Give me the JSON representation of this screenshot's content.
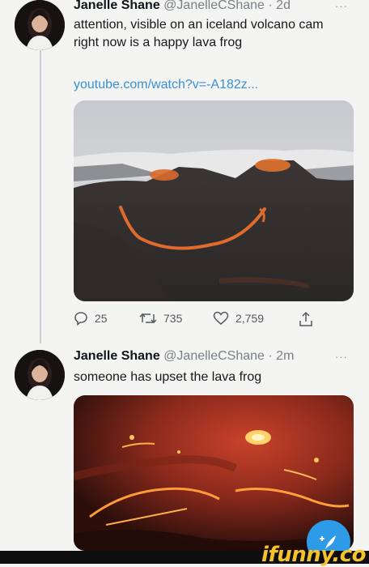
{
  "tweet1": {
    "author_name": "Janelle Shane",
    "handle": "@JanelleCShane",
    "separator": "·",
    "time": "2d",
    "more": "···",
    "text": "attention, visible on an iceland volcano cam right now is a happy lava frog",
    "link": "youtube.com/watch?v=-A182z...",
    "media_icon": "volcano-image",
    "actions": {
      "reply_count": "25",
      "retweet_count": "735",
      "like_count": "2,759"
    }
  },
  "tweet2": {
    "author_name": "Janelle Shane",
    "handle": "@JanelleCShane",
    "separator": "·",
    "time": "2m",
    "more": "···",
    "text": "someone has upset the lava frog",
    "media_icon": "lava-image"
  },
  "compose_button": {
    "icon": "compose-feather-icon",
    "label": "+"
  },
  "watermark": {
    "text": "ifunny.co"
  },
  "colors": {
    "link": "#3a90d4",
    "accent": "#2d9be8",
    "brand": "#f3c22c"
  }
}
